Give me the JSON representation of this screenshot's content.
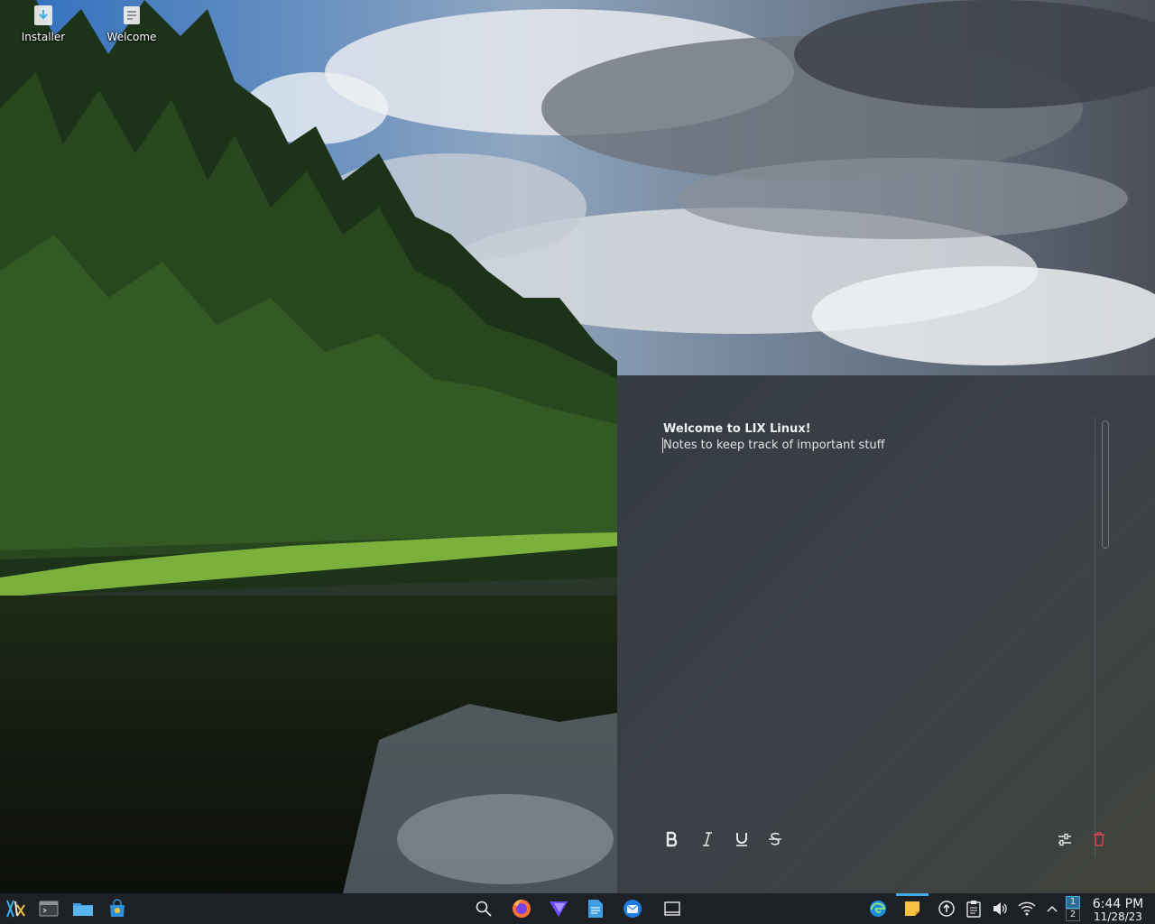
{
  "desktop": {
    "icons": [
      {
        "label": "Installer",
        "icon": "installer-icon"
      },
      {
        "label": "Welcome",
        "icon": "welcome-icon"
      }
    ]
  },
  "note": {
    "title": "Welcome to LIX Linux!",
    "body": "Notes to keep track of important stuff",
    "toolbar": {
      "bold_icon": "bold-icon",
      "italic_icon": "italic-icon",
      "underline_icon": "underline-icon",
      "strikethrough_icon": "strikethrough-icon",
      "settings_icon": "settings-sliders-icon",
      "delete_icon": "trash-icon"
    }
  },
  "taskbar": {
    "left": [
      "app-launcher-icon",
      "terminal-icon",
      "file-manager-icon",
      "software-store-icon"
    ],
    "center": [
      "search-icon",
      "firefox-icon",
      "proton-vpn-icon",
      "text-editor-icon",
      "thunderbird-icon",
      "show-desktop-icon"
    ],
    "tray": [
      "edge-icon",
      "sticky-note-icon",
      "updates-icon",
      "clipboard-icon",
      "volume-icon",
      "wifi-icon",
      "expand-tray-icon"
    ],
    "pager": {
      "desktop1": "1",
      "desktop2": "2"
    },
    "clock": {
      "time": "6:44 PM",
      "date": "11/28/23"
    }
  },
  "colors": {
    "accent": "#3daee9",
    "taskbar_bg": "#1d2024",
    "note_bg": "#3a4046",
    "delete_red": "#da4453"
  }
}
